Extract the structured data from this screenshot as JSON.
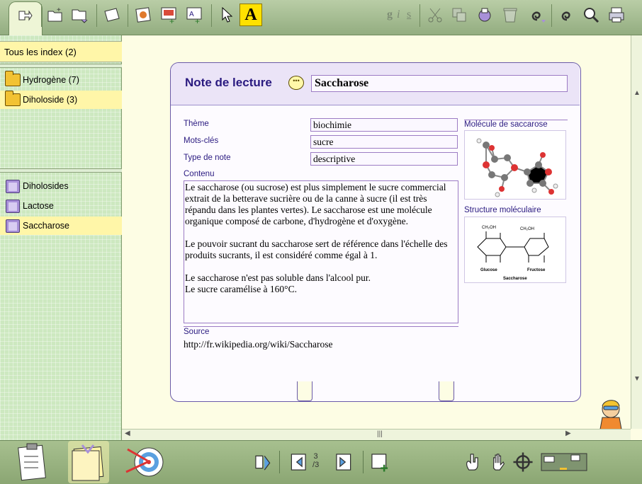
{
  "toolbar": {
    "style_buttons": [
      "g",
      "i",
      "s"
    ],
    "active_tool_label": "A"
  },
  "sidebar": {
    "header": "Tous les index (2)",
    "index_items": [
      {
        "label": "Hydrogène (7)"
      },
      {
        "label": "Diholoside (3)"
      }
    ],
    "note_items": [
      {
        "label": "Diholosides"
      },
      {
        "label": "Lactose"
      },
      {
        "label": "Saccharose"
      }
    ]
  },
  "note": {
    "heading": "Note de lecture",
    "title": "Saccharose",
    "theme_label": "Thème",
    "theme_value": "biochimie",
    "keywords_label": "Mots-clés",
    "keywords_value": "sucre",
    "type_label": "Type de note",
    "type_value": "descriptive",
    "content_label": "Contenu",
    "content": "Le saccharose (ou sucrose) est plus simplement le sucre commercial extrait de la betterave sucrière ou de la canne à sucre (il est très répandu dans les plantes vertes). Le saccharose est une molécule organique composé de carbone, d'hydrogène et d'oxygène.\n\nLe pouvoir sucrant du saccharose sert de référence dans l'échelle des produits sucrants, il est considéré comme égal à 1.\n\nLe saccharose n'est pas soluble dans l'alcool pur.\nLe sucre caramélise à 160°C.",
    "source_label": "Source",
    "source_value": "http://fr.wikipedia.org/wiki/Saccharose",
    "image1_label": "Molécule de saccarose",
    "image2_label": "Structure moléculaire",
    "structure_labels": {
      "left_top": "CH₂OH",
      "right_top": "CH₂OH",
      "glucose": "Glucose",
      "fructose": "Fructose",
      "name": "Saccharose"
    }
  },
  "pager": {
    "current": "3",
    "total": "3"
  },
  "colors": {
    "accent": "#2a1a80",
    "selection": "#fff6a8",
    "toolbar": "#a7c08f"
  }
}
